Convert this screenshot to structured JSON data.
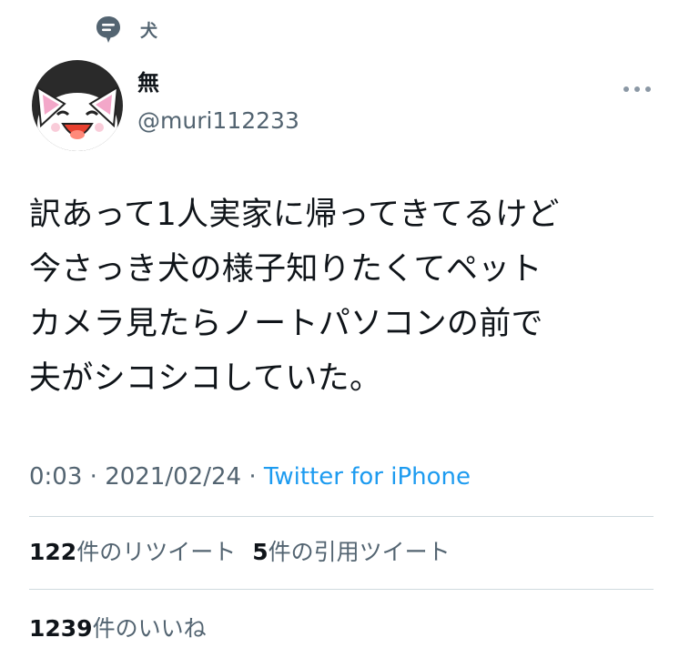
{
  "context": {
    "label": "犬",
    "icon": "topic-icon"
  },
  "author": {
    "display_name": "無",
    "handle": "@muri112233",
    "avatar": "cat-avatar"
  },
  "menu": {
    "icon": "more-icon"
  },
  "tweet": {
    "lines": [
      "訳あって1人実家に帰ってきてるけど",
      "今さっき犬の様子知りたくてペット",
      "カメラ見たらノートパソコンの前で",
      "夫がシコシコしていた。"
    ]
  },
  "meta": {
    "time": "0:03",
    "separator": "·",
    "date": "2021/02/24",
    "source": "Twitter for iPhone"
  },
  "stats": {
    "retweets": {
      "count": "122",
      "label": "件のリツイート"
    },
    "quotes": {
      "count": "5",
      "label": "件の引用ツイート"
    },
    "likes": {
      "count": "1239",
      "label": "件のいいね"
    }
  },
  "colors": {
    "text": "#0f1419",
    "secondary": "#536471",
    "link": "#1d9bf0",
    "divider": "#cfd9de"
  }
}
